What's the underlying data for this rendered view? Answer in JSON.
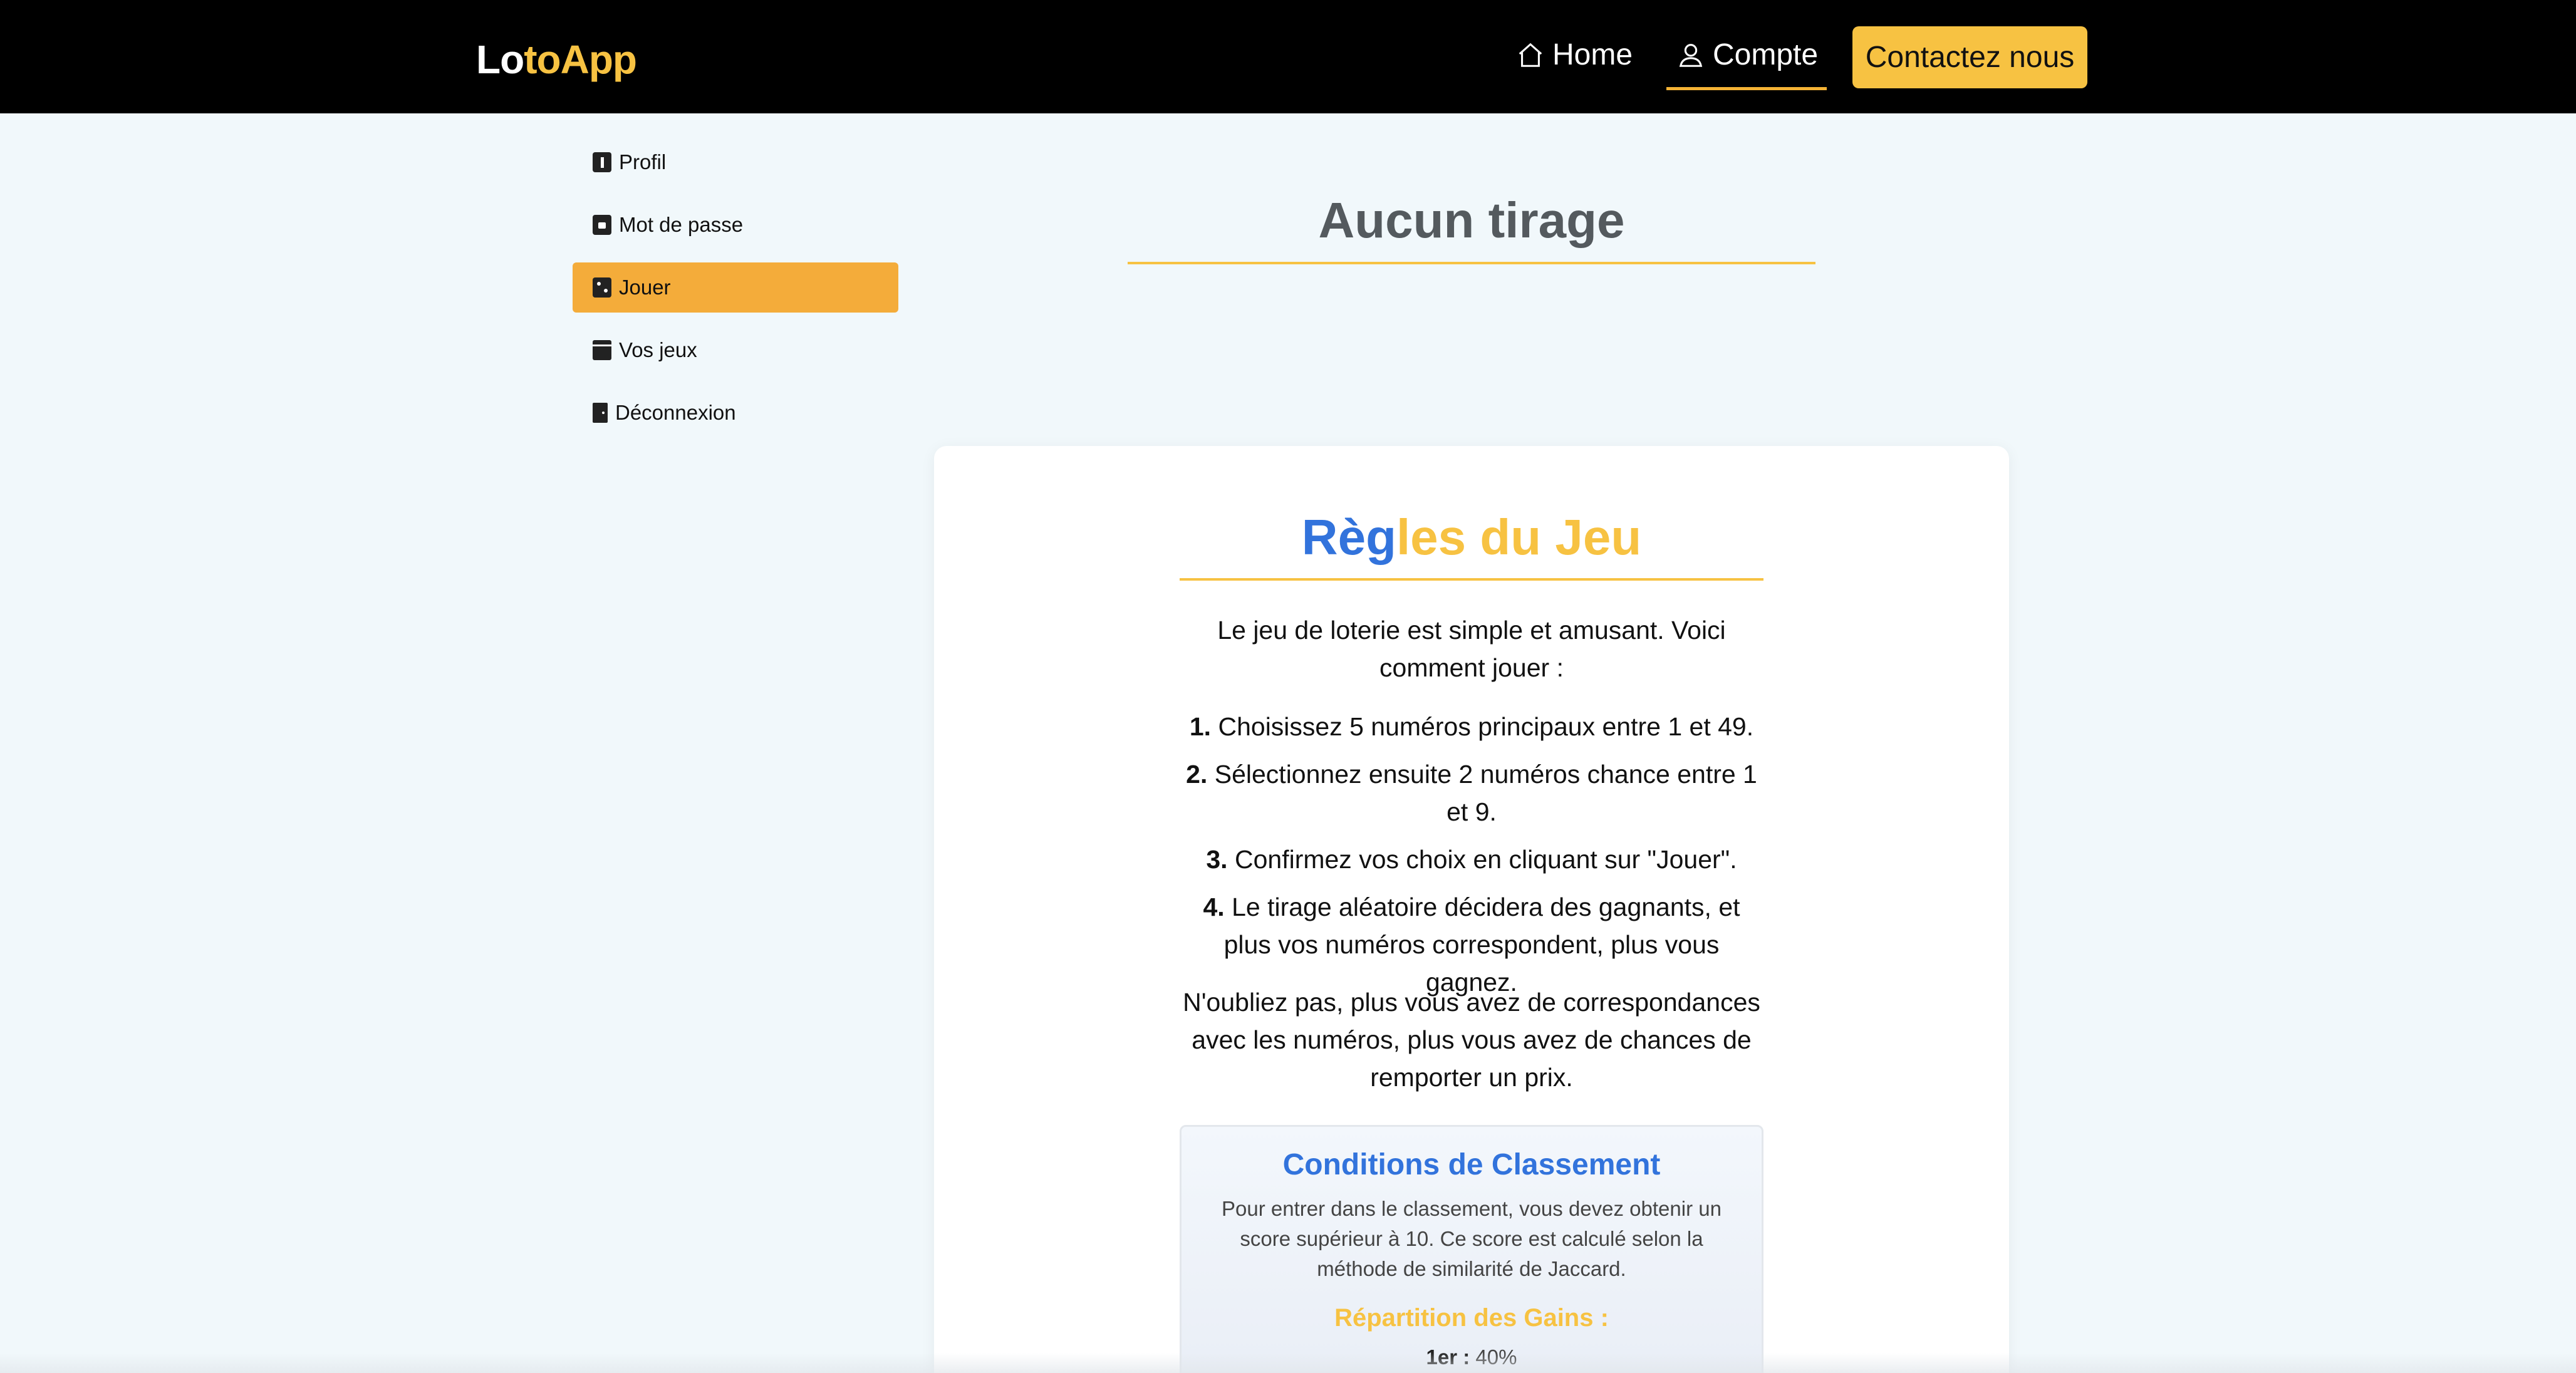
{
  "brand": {
    "part1": "Lo",
    "part2": "toApp"
  },
  "nav": {
    "home": {
      "label": "Home",
      "icon": "home-icon"
    },
    "compte": {
      "label": "Compte",
      "icon": "user-icon"
    },
    "contact": "Contactez nous"
  },
  "sidebar": {
    "items": [
      {
        "label": "Profil",
        "icon": "info-icon"
      },
      {
        "label": "Mot de passe",
        "icon": "lock-icon"
      },
      {
        "label": "Jouer",
        "icon": "dice-icon",
        "active": true
      },
      {
        "label": "Vos jeux",
        "icon": "calendar-check-icon"
      },
      {
        "label": "Déconnexion",
        "icon": "door-icon"
      }
    ]
  },
  "main": {
    "title": "Aucun tirage"
  },
  "rules": {
    "title_part1": "Règ",
    "title_part2": "les du Jeu",
    "intro": "Le jeu de loterie est simple et amusant. Voici comment jouer :",
    "steps": [
      {
        "num": "1.",
        "text": "Choisissez 5 numéros principaux entre 1 et 49."
      },
      {
        "num": "2.",
        "text": "Sélectionnez ensuite 2 numéros chance entre 1 et 9."
      },
      {
        "num": "3.",
        "text": "Confirmez vos choix en cliquant sur \"Jouer\"."
      },
      {
        "num": "4.",
        "text": "Le tirage aléatoire décidera des gagnants, et plus vos numéros correspondent, plus vous gagnez."
      }
    ],
    "outro": "N'oubliez pas, plus vous avez de correspondances avec les numéros, plus vous avez de chances de remporter un prix."
  },
  "conditions": {
    "title": "Conditions de Classement",
    "text": "Pour entrer dans le classement, vous devez obtenir un score supérieur à 10. Ce score est calculé selon la méthode de similarité de Jaccard.",
    "gains_title": "Répartition des Gains :",
    "gains": [
      {
        "rank": "1er :",
        "value": "40%"
      }
    ]
  },
  "colors": {
    "accent": "#f7c242",
    "active": "#f4ac3a",
    "blue": "#3273dc",
    "background": "#f1f8fb"
  }
}
